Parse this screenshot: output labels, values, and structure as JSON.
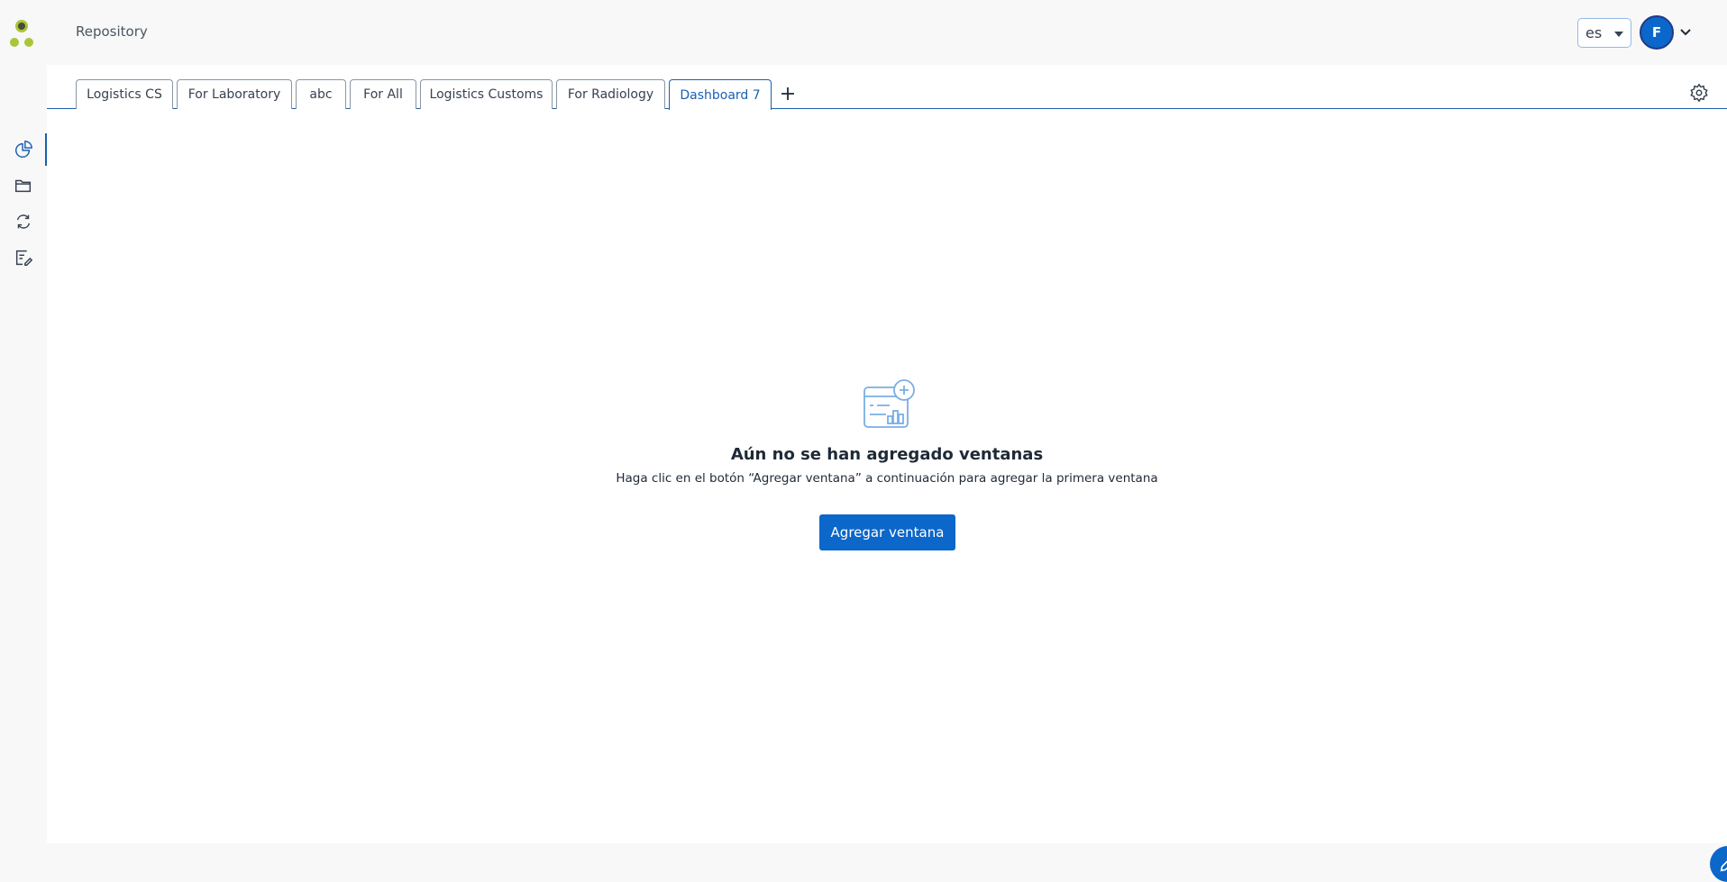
{
  "header": {
    "title": "Repository",
    "language": "es",
    "avatar_initial": "F"
  },
  "sidebar": {
    "items": [
      {
        "name": "dashboards",
        "icon": "pie-chart-icon",
        "active": true
      },
      {
        "name": "repository",
        "icon": "folder-icon",
        "active": false
      },
      {
        "name": "sync",
        "icon": "refresh-icon",
        "active": false
      },
      {
        "name": "reports",
        "icon": "edit-document-icon",
        "active": false
      }
    ]
  },
  "tabs": [
    {
      "label": "Logistics CS",
      "active": false
    },
    {
      "label": "For Laboratory",
      "active": false
    },
    {
      "label": "abc",
      "active": false
    },
    {
      "label": "For All",
      "active": false
    },
    {
      "label": "Logistics Customs",
      "active": false
    },
    {
      "label": "For Radiology",
      "active": false
    },
    {
      "label": "Dashboard 7",
      "active": true
    }
  ],
  "empty_state": {
    "title": "Aún no se han agregado ventanas",
    "subtitle": "Haga clic en el botón “Agregar ventana” a continuación para agregar la primera ventana",
    "button_label": "Agregar ventana"
  },
  "colors": {
    "accent": "#0b67c9",
    "tab_active": "#1c5fb0",
    "logo_dark": "#4a4a3a",
    "logo_green": "#a8c63a"
  }
}
